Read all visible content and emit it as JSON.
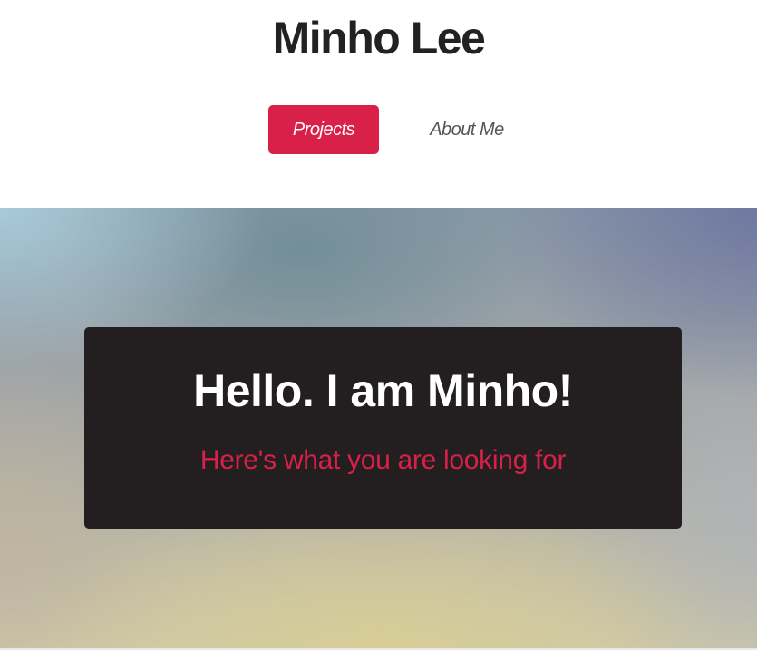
{
  "site": {
    "title": "Minho Lee"
  },
  "nav": {
    "items": [
      {
        "label": "Projects",
        "active": true
      },
      {
        "label": "About Me",
        "active": false
      }
    ]
  },
  "hero": {
    "title": "Hello. I am Minho!",
    "subtitle": "Here's what you are looking for"
  },
  "colors": {
    "accent": "#d82048",
    "card_background": "#231f20",
    "title_text": "#222222"
  }
}
